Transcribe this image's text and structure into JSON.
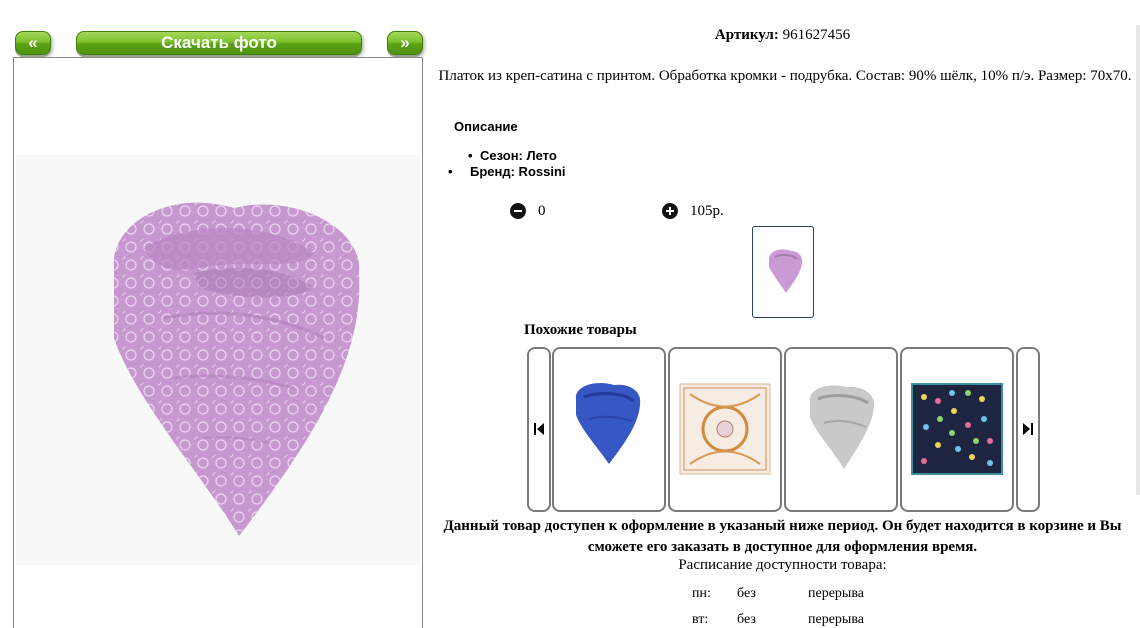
{
  "nav": {
    "prev_label": "«",
    "download_label": "Скачать фото",
    "next_label": "»"
  },
  "product": {
    "article_label": "Артикул:",
    "article_value": "961627456",
    "description": "Платок из креп-сатина с принтом. Обработка кромки - подрубка. Состав: 90% шёлк, 10% п/э. Размер: 70х70.",
    "section_title": "Описание",
    "properties": [
      "Сезон: Лето",
      "Бренд: Rossini"
    ],
    "quantity": "0",
    "price": "105р."
  },
  "similar": {
    "title": "Похожие товары",
    "items": [
      {
        "name": "blue-scarf"
      },
      {
        "name": "beige-pattern-scarf"
      },
      {
        "name": "gray-scarf"
      },
      {
        "name": "dark-dotted-scarf"
      }
    ]
  },
  "availability": {
    "notice": "Данный товар доступен к оформление в указаный ниже период. Он будет находится в корзине и Вы сможете его заказать в доступное для оформления время.",
    "schedule_title": "Расписание доступности товара:",
    "rows": [
      {
        "day": "пн:",
        "from": "без",
        "to": "перерыва"
      },
      {
        "day": "вт:",
        "from": "без",
        "to": "перерыва"
      }
    ]
  },
  "colors": {
    "button_green": "#5aa213",
    "scarf_lilac": "#c99ad3",
    "thumb_border": "#2b3e64"
  }
}
